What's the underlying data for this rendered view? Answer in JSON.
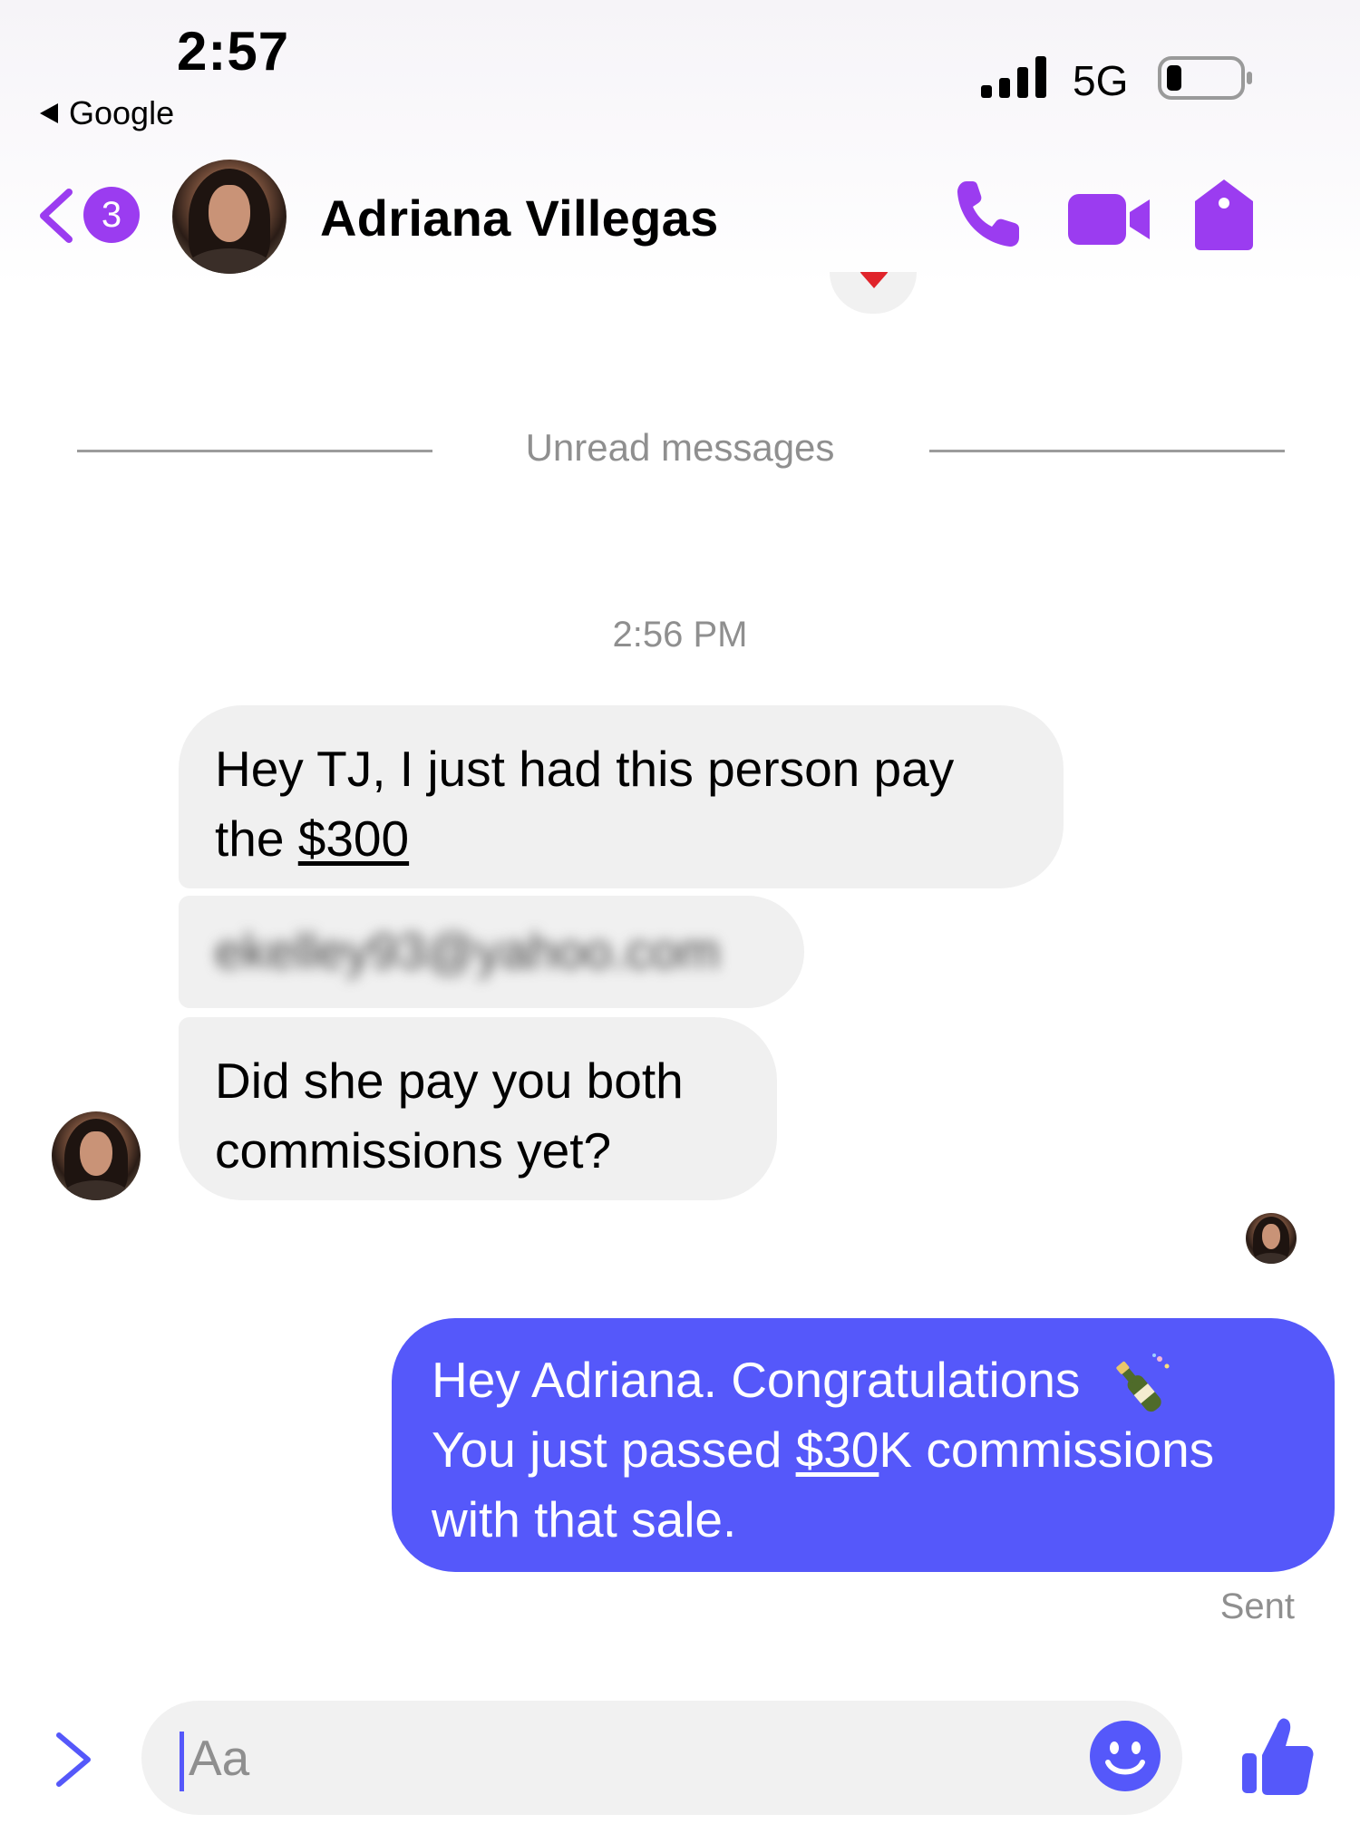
{
  "status_bar": {
    "time": "2:57",
    "back_app": "Google",
    "network": "5G"
  },
  "header": {
    "back_badge_count": "3",
    "contact_name": "Adriana Villegas",
    "icons": [
      "back-chevron-icon",
      "phone-icon",
      "video-camera-icon",
      "tag-icon"
    ]
  },
  "conversation": {
    "unread_divider": "Unread messages",
    "timestamp": "2:56 PM",
    "incoming": [
      {
        "before": "Hey TJ, I just had this person pay the ",
        "link": "$300"
      },
      {
        "blurred": "ekelley93@yahoo.com"
      },
      {
        "text": "Did she pay you both commissions yet?"
      }
    ],
    "outgoing": {
      "line1": "Hey Adriana. Congratulations",
      "line2_before": "You just passed ",
      "line2_link": "$30",
      "line2_after": "K commissions",
      "line3": "with that sale."
    },
    "sent_status": "Sent"
  },
  "composer": {
    "placeholder": "Aa"
  },
  "colors": {
    "accent_purple": "#9b3cf0",
    "outgoing_bubble": "#5558fa",
    "incoming_bubble": "#f0f0f0"
  }
}
